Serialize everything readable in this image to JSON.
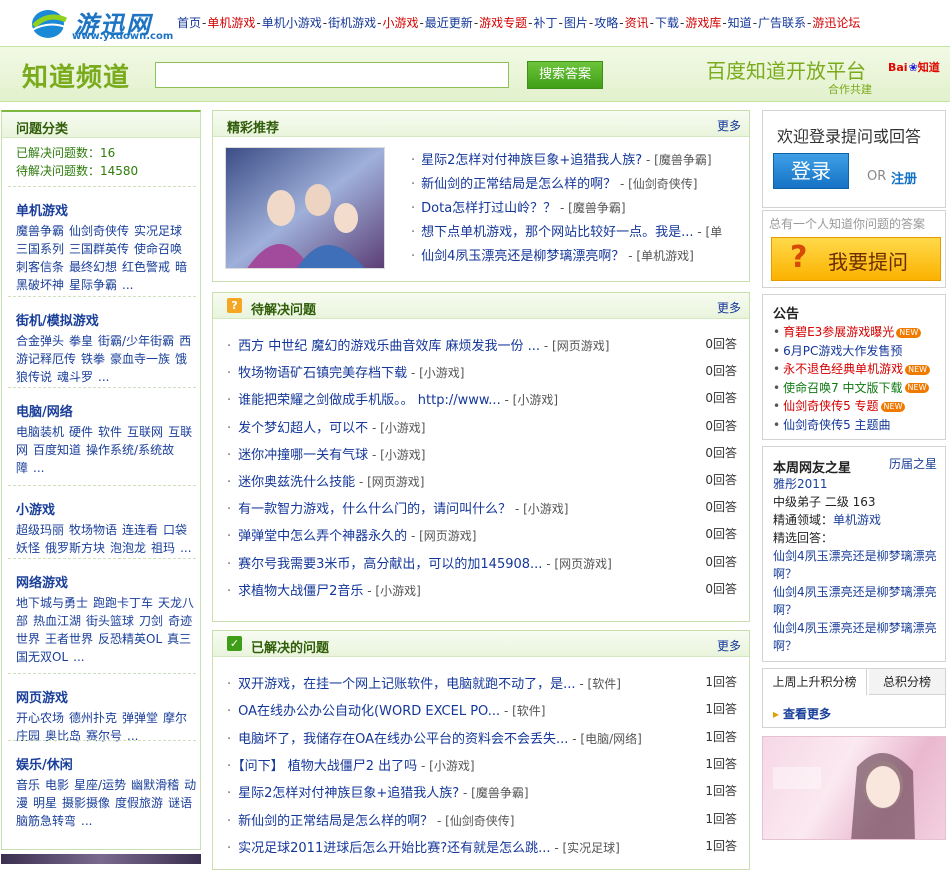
{
  "logo": {
    "text": "游迅网",
    "url": "www.yxdown.com"
  },
  "topnav": [
    {
      "label": "首页",
      "color": "#14379a"
    },
    {
      "label": "单机游戏",
      "color": "#d40000"
    },
    {
      "label": "单机小游戏",
      "color": "#14379a"
    },
    {
      "label": "街机游戏",
      "color": "#14379a"
    },
    {
      "label": "小游戏",
      "color": "#d40000"
    },
    {
      "label": "最近更新",
      "color": "#14379a"
    },
    {
      "label": "游戏专题",
      "color": "#d40000"
    },
    {
      "label": "补丁",
      "color": "#14379a"
    },
    {
      "label": "图片",
      "color": "#14379a"
    },
    {
      "label": "攻略",
      "color": "#14379a"
    },
    {
      "label": "资讯",
      "color": "#d40000"
    },
    {
      "label": "下载",
      "color": "#14379a"
    },
    {
      "label": "游戏库",
      "color": "#d40000"
    },
    {
      "label": "知道",
      "color": "#14379a"
    },
    {
      "label": "广告联系",
      "color": "#14379a"
    },
    {
      "label": "游迅论坛",
      "color": "#d40000"
    }
  ],
  "header": {
    "channel_title": "知道频道",
    "search_placeholder": "",
    "search_button": "搜索答案",
    "baidu_title": "百度知道开放平台",
    "baidu_sub": "合作共建",
    "baidu_logo_bai": "Bai",
    "baidu_logo_du": "du",
    "baidu_logo_zhidao": "知道"
  },
  "left": {
    "title": "问题分类",
    "stats": [
      {
        "text": "已解决问题数：16"
      },
      {
        "text": "待解决问题数：14580"
      }
    ],
    "categories": [
      {
        "title": "单机游戏",
        "links": [
          "魔兽争霸",
          "仙剑奇侠传",
          "实况足球",
          "三国系列",
          "三国群英传",
          "使命召唤",
          "刺客信条",
          "最终幻想",
          "红色警戒",
          "暗黑破坏神",
          "星际争霸",
          "..."
        ]
      },
      {
        "title": "街机/模拟游戏",
        "links": [
          "合金弹头",
          "拳皇",
          "街霸/少年街霸",
          "西游记释厄传",
          "铁拳",
          "豪血寺一族",
          "饿狼传说",
          "魂斗罗",
          "..."
        ]
      },
      {
        "title": "电脑/网络",
        "links": [
          "电脑装机",
          "硬件",
          "软件",
          "互联网",
          "互联网",
          "百度知道",
          "操作系统/系统故障",
          "..."
        ]
      },
      {
        "title": "小游戏",
        "links": [
          "超级玛丽",
          "牧场物语",
          "连连看",
          "口袋妖怪",
          "俄罗斯方块",
          "泡泡龙",
          "祖玛",
          "..."
        ]
      },
      {
        "title": "网络游戏",
        "links": [
          "地下城与勇士",
          "跑跑卡丁车",
          "天龙八部",
          "热血江湖",
          "街头篮球",
          "刀剑",
          "奇迹世界",
          "王者世界",
          "反恐精英OL",
          "真三国无双OL",
          "..."
        ]
      },
      {
        "title": "网页游戏",
        "links": [
          "开心农场",
          "德州扑克",
          "弹弹堂",
          "摩尔庄园",
          "奥比岛",
          "赛尔号",
          "..."
        ]
      },
      {
        "title": "娱乐/休闲",
        "links": [
          "音乐",
          "电影",
          "星座/运势",
          "幽默滑稽",
          "动漫",
          "明星",
          "摄影摄像",
          "度假旅游",
          "谜语",
          "脑筋急转弯",
          "..."
        ]
      }
    ]
  },
  "recommend": {
    "title": "精彩推荐",
    "more": "更多",
    "items": [
      {
        "q": "星际2怎样对付神族巨象+追猎我人族?",
        "tag": " - [魔兽争霸]"
      },
      {
        "q": "新仙剑的正常结局是怎么样的啊？",
        "tag": " - [仙剑奇侠传]"
      },
      {
        "q": "Dota怎样打过山岭？？",
        "tag": " - [魔兽争霸]"
      },
      {
        "q": "想下点单机游戏，那个网站比较好一点。我是...",
        "tag": " - [单"
      },
      {
        "q": "仙剑4夙玉漂亮还是柳梦璃漂亮啊？",
        "tag": " - [单机游戏]"
      }
    ]
  },
  "pending": {
    "title": "待解决问题",
    "more": "更多",
    "items": [
      {
        "q": "西方 中世纪 魔幻的游戏乐曲音效库 麻烦发我一份 ...",
        "tag": " - [网页游戏]",
        "ans": "0回答"
      },
      {
        "q": "牧场物语矿石镇完美存档下载",
        "tag": " - [小游戏]",
        "ans": "0回答"
      },
      {
        "q": "谁能把荣耀之剑做成手机版。。 http://www...",
        "tag": " - [小游戏]",
        "ans": "0回答"
      },
      {
        "q": "发个梦幻超人，可以不",
        "tag": " - [小游戏]",
        "ans": "0回答"
      },
      {
        "q": "迷你冲撞哪一关有气球",
        "tag": " - [小游戏]",
        "ans": "0回答"
      },
      {
        "q": "迷你奥兹洗什么技能",
        "tag": " - [网页游戏]",
        "ans": "0回答"
      },
      {
        "q": "有一款智力游戏，什么什么门的，请问叫什么？",
        "tag": " - [小游戏]",
        "ans": "0回答"
      },
      {
        "q": "弹弹堂中怎么弄个神器永久的",
        "tag": " - [网页游戏]",
        "ans": "0回答"
      },
      {
        "q": "赛尔号我需要3米币，高分献出，可以的加145908...",
        "tag": " - [网页游戏]",
        "ans": "0回答"
      },
      {
        "q": "求植物大战僵尸2音乐",
        "tag": " - [小游戏]",
        "ans": "0回答"
      }
    ]
  },
  "solved": {
    "title": "已解决的问题",
    "more": "更多",
    "items": [
      {
        "q": "双开游戏，在挂一个网上记账软件，电脑就跑不动了，是...",
        "tag": " - [软件]",
        "ans": "1回答"
      },
      {
        "q": "OA在线办公办公自动化(WORD EXCEL PO...",
        "tag": " - [软件]",
        "ans": "1回答"
      },
      {
        "q": "电脑坏了，我储存在OA在线办公平台的资料会不会丢失...",
        "tag": " - [电脑/网络]",
        "ans": "1回答"
      },
      {
        "q": "【问下】 植物大战僵尸2 出了吗",
        "tag": " - [小游戏]",
        "ans": "1回答"
      },
      {
        "q": "星际2怎样对付神族巨象+追猎我人族?",
        "tag": " - [魔兽争霸]",
        "ans": "1回答"
      },
      {
        "q": "新仙剑的正常结局是怎么样的啊？",
        "tag": " - [仙剑奇侠传]",
        "ans": "1回答"
      },
      {
        "q": "实况足球2011进球后怎么开始比赛?还有就是怎么跳...",
        "tag": " - [实况足球]",
        "ans": "1回答"
      }
    ]
  },
  "login": {
    "title": "欢迎登录提问或回答",
    "button": "登录",
    "or": "OR",
    "register": "注册"
  },
  "ask": {
    "hint": "总有一个人知道你问题的答案",
    "icon": "?",
    "button": "我要提问"
  },
  "notice": {
    "title": "公告",
    "new_badge": "NEW",
    "items": [
      {
        "text": "育碧E3参展游戏曝光",
        "color": "#d40000",
        "new": true
      },
      {
        "text": "6月PC游戏大作发售预",
        "color": "#14379a",
        "new": false
      },
      {
        "text": "永不退色经典单机游戏",
        "color": "#d40000",
        "new": true
      },
      {
        "text": "使命召唤7 中文版下载",
        "color": "#0e7a12",
        "new": true
      },
      {
        "text": "仙剑奇侠传5 专题",
        "color": "#d40000",
        "new": true
      },
      {
        "text": "仙剑奇侠传5 主题曲",
        "color": "#14379a",
        "new": false
      }
    ]
  },
  "star": {
    "title": "本周网友之星",
    "history": "历届之星",
    "user": "雅彤2011",
    "rank": "中级弟子 二级 163",
    "field_label": "精通领域：",
    "field": "单机游戏",
    "answers_label": "精选回答：",
    "answers": [
      "仙剑4夙玉漂亮还是柳梦璃漂亮啊？",
      "仙剑4夙玉漂亮还是柳梦璃漂亮啊？",
      "仙剑4夙玉漂亮还是柳梦璃漂亮啊？"
    ]
  },
  "ranking": {
    "tab_week": "上周上升积分榜",
    "tab_total": "总积分榜",
    "see_more": "查看更多"
  }
}
